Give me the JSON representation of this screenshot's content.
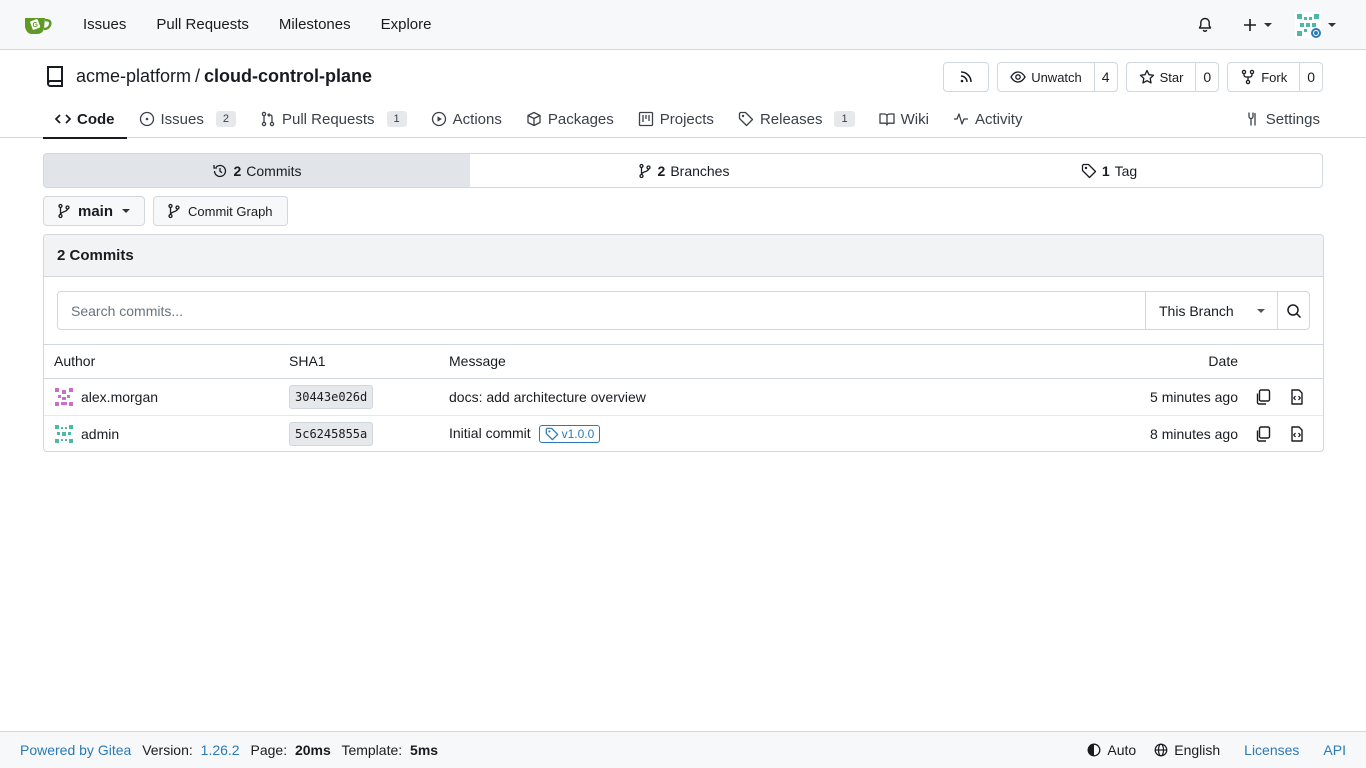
{
  "topnav": {
    "items": [
      "Issues",
      "Pull Requests",
      "Milestones",
      "Explore"
    ]
  },
  "repo": {
    "owner": "acme-platform",
    "separator": "/",
    "name": "cloud-control-plane",
    "watch_label": "Unwatch",
    "watch_count": "4",
    "star_label": "Star",
    "star_count": "0",
    "fork_label": "Fork",
    "fork_count": "0"
  },
  "tabs": [
    {
      "label": "Code",
      "badge": ""
    },
    {
      "label": "Issues",
      "badge": "2"
    },
    {
      "label": "Pull Requests",
      "badge": "1"
    },
    {
      "label": "Actions",
      "badge": ""
    },
    {
      "label": "Packages",
      "badge": ""
    },
    {
      "label": "Projects",
      "badge": ""
    },
    {
      "label": "Releases",
      "badge": "1"
    },
    {
      "label": "Wiki",
      "badge": ""
    },
    {
      "label": "Activity",
      "badge": ""
    }
  ],
  "settings_label": "Settings",
  "summary": {
    "commits_count": "2",
    "commits_label": "Commits",
    "branches_count": "2",
    "branches_label": "Branches",
    "tags_count": "1",
    "tags_label": "Tag"
  },
  "branch": {
    "current": "main",
    "graph_label": "Commit Graph"
  },
  "commits_box": {
    "title": "2 Commits",
    "search_placeholder": "Search commits...",
    "scope": "This Branch",
    "columns": {
      "author": "Author",
      "sha": "SHA1",
      "message": "Message",
      "date": "Date"
    },
    "rows": [
      {
        "author": "alex.morgan",
        "sha": "30443e026d",
        "message": "docs: add architecture overview",
        "tag": "",
        "date": "5 minutes ago"
      },
      {
        "author": "admin",
        "sha": "5c6245855a",
        "message": "Initial commit",
        "tag": "v1.0.0",
        "date": "8 minutes ago"
      }
    ]
  },
  "footer": {
    "powered": "Powered by Gitea",
    "version_label": "Version:",
    "version": "1.26.2",
    "page_label": "Page:",
    "page_time": "20ms",
    "template_label": "Template:",
    "template_time": "5ms",
    "theme": "Auto",
    "language": "English",
    "licenses": "Licenses",
    "api": "API"
  },
  "colors": {
    "link": "#2a7ab7",
    "gitea_green": "#609926"
  }
}
